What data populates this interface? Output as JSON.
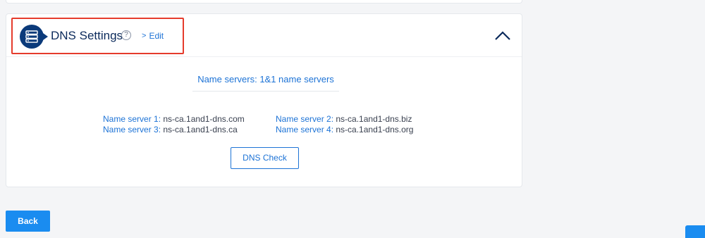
{
  "dns_settings": {
    "title": "DNS Settings",
    "help_icon": "?",
    "edit_label": "Edit",
    "edit_chevron": ">",
    "icon": "server-icon",
    "collapse_icon": "chevron-up-icon"
  },
  "name_servers": {
    "heading": "Name servers: 1&1 name servers",
    "items": [
      {
        "label": "Name server 1:",
        "value": "ns-ca.1and1-dns.com"
      },
      {
        "label": "Name server 2:",
        "value": "ns-ca.1and1-dns.biz"
      },
      {
        "label": "Name server 3:",
        "value": "ns-ca.1and1-dns.ca"
      },
      {
        "label": "Name server 4:",
        "value": "ns-ca.1and1-dns.org"
      }
    ]
  },
  "actions": {
    "dns_check_label": "DNS Check",
    "back_label": "Back"
  },
  "colors": {
    "accent": "#1d73d6",
    "primary_button": "#1a8cf0",
    "highlight": "#e53b2c",
    "navy": "#0b3a7a"
  }
}
